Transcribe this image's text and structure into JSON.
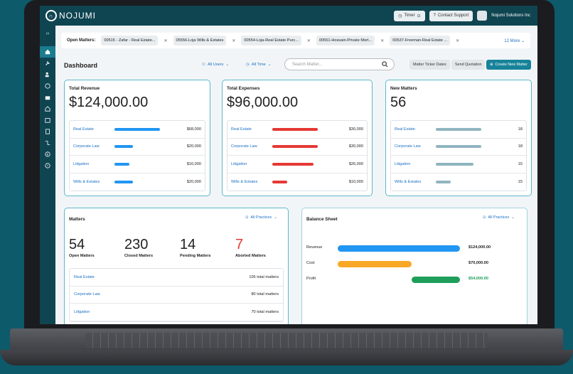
{
  "app": {
    "logo_text": "NOJUMI",
    "org_name": "Nojumi Solutions Inc"
  },
  "topbar": {
    "timer_label": "Timer",
    "support_label": "Contact Support"
  },
  "open_matters": {
    "label": "Open Matters:",
    "chips": [
      "00515 - Zafar - Real Estate...",
      "05556-Loja Wills & Estates",
      "00554-Loja-Real Estate Purc...",
      "00551-Hossain-Private Mort...",
      "00537-Freeman-Real Estate ..."
    ],
    "more_label": "12 More"
  },
  "dashboard": {
    "title": "Dashboard",
    "users_filter": "All Users",
    "time_filter": "All Time",
    "search_placeholder": "Search Matter...",
    "ticker_label": "Matter Ticker Dates",
    "quotation_label": "Send Quotation",
    "create_label": "Create New Matter"
  },
  "revenue": {
    "title": "Total Revenue",
    "total": "$124,000.00",
    "color": "#2196f3",
    "rows": [
      {
        "label": "Real Estate",
        "value": "$68,000",
        "fraction": 1.0
      },
      {
        "label": "Corporate Law",
        "value": "$20,000",
        "fraction": 0.4
      },
      {
        "label": "Litigation",
        "value": "$16,000",
        "fraction": 0.33
      },
      {
        "label": "Wills & Estates",
        "value": "$20,000",
        "fraction": 0.4
      }
    ]
  },
  "expenses": {
    "title": "Total Expenses",
    "total": "$96,000.00",
    "color": "#e53935",
    "rows": [
      {
        "label": "Real Estate",
        "value": "$30,000",
        "fraction": 1.0
      },
      {
        "label": "Corporate Law",
        "value": "$30,000",
        "fraction": 1.0
      },
      {
        "label": "Litigation",
        "value": "$26,000",
        "fraction": 0.9
      },
      {
        "label": "Wills & Estates",
        "value": "$10,000",
        "fraction": 0.33
      }
    ]
  },
  "new_matters": {
    "title": "New Matters",
    "total": "56",
    "color": "#8fb5bf",
    "rows": [
      {
        "label": "Real Estate",
        "value": "18",
        "fraction": 1.0
      },
      {
        "label": "Corporate Law",
        "value": "18",
        "fraction": 1.0
      },
      {
        "label": "Litigation",
        "value": "15",
        "fraction": 0.83
      },
      {
        "label": "Wills & Estates",
        "value": "15",
        "fraction": 0.33
      }
    ]
  },
  "matters": {
    "title": "Matters",
    "practices_filter": "All Practices",
    "stats": [
      {
        "num": "54",
        "label": "Open Matters"
      },
      {
        "num": "230",
        "label": "Closed Matters"
      },
      {
        "num": "14",
        "label": "Pending Matters"
      },
      {
        "num": "7",
        "label": "Aborted Matters"
      }
    ],
    "rows": [
      {
        "label": "Real Estate",
        "value": "105 total matters"
      },
      {
        "label": "Corporate Law",
        "value": "80 total matters"
      },
      {
        "label": "Litigation",
        "value": "70 total matters"
      }
    ]
  },
  "balance_sheet": {
    "title": "Balance Sheet",
    "practices_filter": "All Practices",
    "rows": [
      {
        "label": "Revenue",
        "value": "$124,000.00",
        "color": "#2196f3"
      },
      {
        "label": "Cost",
        "value": "$70,000.00",
        "color": "#f9a825"
      },
      {
        "label": "Profit",
        "value": "$54,000.00",
        "color": "#1e9e5a"
      }
    ]
  }
}
